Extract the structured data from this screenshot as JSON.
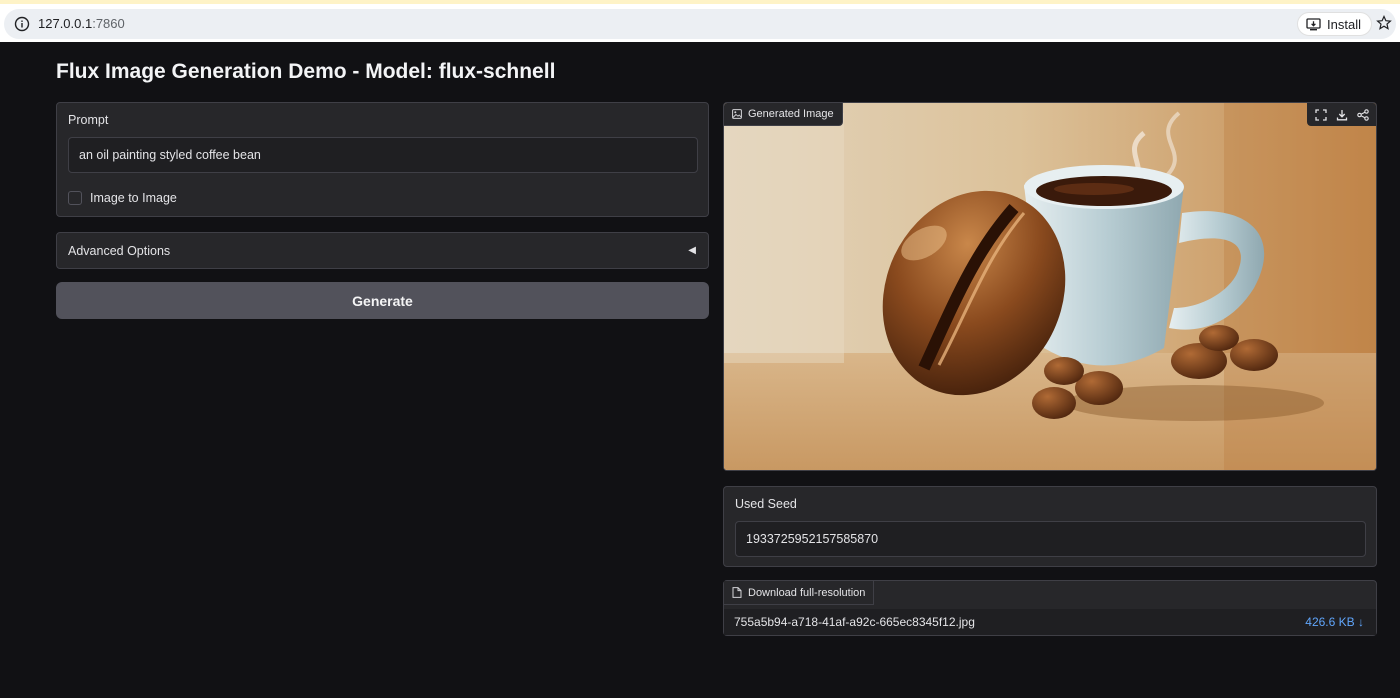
{
  "browser": {
    "url_host": "127.0.0.1",
    "url_port": ":7860",
    "install_label": "Install"
  },
  "app": {
    "title": "Flux Image Generation Demo - Model: flux-schnell",
    "prompt": {
      "label": "Prompt",
      "value": "an oil painting styled coffee bean"
    },
    "img2img": {
      "label": "Image to Image",
      "checked": false
    },
    "advanced": {
      "label": "Advanced Options",
      "arrow": "◀"
    },
    "generate_label": "Generate",
    "output_image": {
      "label": "Generated Image",
      "tools": [
        "fullscreen-icon",
        "download-icon",
        "share-icon"
      ]
    },
    "seed": {
      "label": "Used Seed",
      "value": "1933725952157585870"
    },
    "download": {
      "label": "Download full-resolution",
      "filename": "755a5b94-a718-41af-a92c-665ec8345f12.jpg",
      "size": "426.6 KB ↓"
    }
  },
  "colors": {
    "app_bg": "#111114",
    "panel_bg": "#27272a",
    "button_bg": "#52525b",
    "link": "#60a5fa"
  }
}
